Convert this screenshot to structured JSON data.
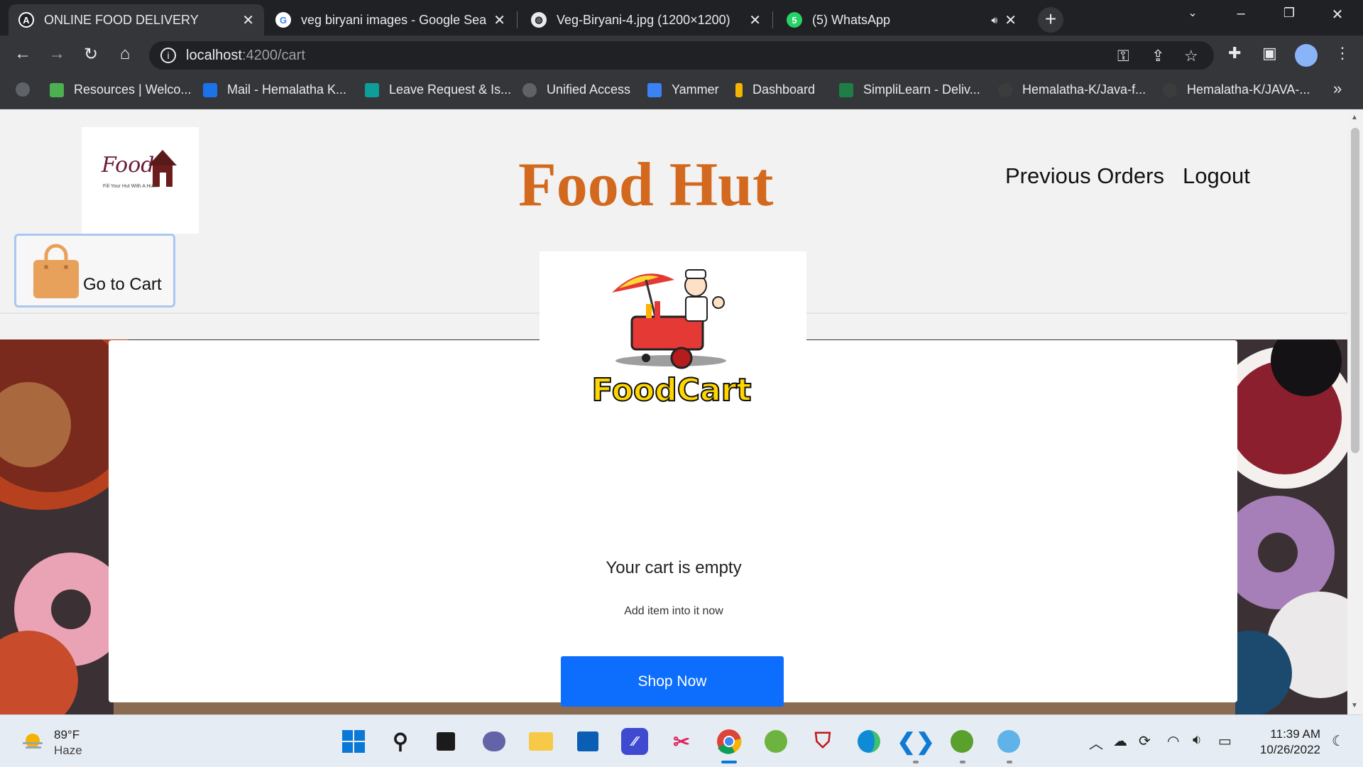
{
  "browser": {
    "tabs": [
      {
        "title": "ONLINE FOOD DELIVERY",
        "favicon": "angular-icon",
        "active": true
      },
      {
        "title": "veg biryani images - Google Sear",
        "favicon": "google-icon",
        "active": false
      },
      {
        "title": "Veg-Biryani-4.jpg (1200×1200)",
        "favicon": "globe-icon",
        "active": false
      },
      {
        "title": "(5) WhatsApp",
        "favicon": "whatsapp-icon",
        "active": false
      }
    ],
    "address": {
      "host": "localhost",
      "path": ":4200/cart"
    },
    "bookmarks": [
      {
        "label": "Resources | Welco...",
        "icon": "home-icon",
        "color": "#4caf50"
      },
      {
        "label": "Mail - Hemalatha K...",
        "icon": "outlook-icon",
        "color": "#1a73e8"
      },
      {
        "label": "Leave Request & Is...",
        "icon": "forms-icon",
        "color": "#0f9d9a"
      },
      {
        "label": "Unified Access",
        "icon": "globe-icon",
        "color": "#5f6368"
      },
      {
        "label": "Yammer",
        "icon": "yammer-icon",
        "color": "#3b82f6"
      },
      {
        "label": "Dashboard",
        "icon": "chart-icon",
        "color": "#f4b400"
      },
      {
        "label": "SimpliLearn - Deliv...",
        "icon": "excel-icon",
        "color": "#1e7e45"
      },
      {
        "label": "Hemalatha-K/Java-f...",
        "icon": "github-icon",
        "color": "#3c3c3c"
      },
      {
        "label": "Hemalatha-K/JAVA-...",
        "icon": "github-icon",
        "color": "#3c3c3c"
      }
    ],
    "more_bookmarks": "»"
  },
  "header": {
    "logo_text": "Food",
    "logo_tagline": "Fill Your Hut With A Hut...",
    "title": "Food Hut",
    "nav": [
      "Previous Orders",
      "Logout"
    ],
    "cart_button_label": "Go to Cart"
  },
  "cart": {
    "logo_text": "FoodCart",
    "empty_title": "Your cart is empty",
    "empty_subtitle": "Add item into it now",
    "shop_button": "Shop Now"
  },
  "taskbar": {
    "weather_temp": "89°F",
    "weather_cond": "Haze",
    "time": "11:39 AM",
    "date": "10/26/2022",
    "whatsapp_badge": "5"
  },
  "colors": {
    "title": "#d2691e",
    "shop_button": "#0d6efd",
    "cart_bag": "#e8a15a"
  }
}
